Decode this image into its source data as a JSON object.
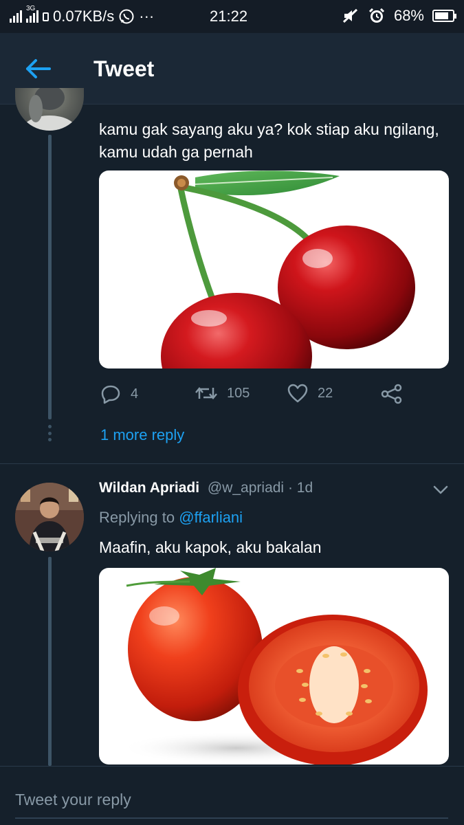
{
  "status_bar": {
    "network": "3G",
    "speed": "0.07KB/s",
    "more": "···",
    "time": "21:22",
    "battery": "68%",
    "battery_level": 0.68
  },
  "header": {
    "title": "Tweet",
    "back_icon": "arrow-left-icon",
    "accent": "#1da1f2"
  },
  "tweets": [
    {
      "text": "kamu gak sayang aku ya? kok stiap aku ngilang, kamu udah ga pernah",
      "media_icon": "cherry-image",
      "replies": "4",
      "retweets": "105",
      "likes": "22",
      "more_replies": "1 more reply"
    },
    {
      "name": "Wildan Apriadi",
      "handle": "@w_apriadi",
      "time": "· 1d",
      "replying_prefix": "Replying to",
      "replying_handle": "@ffarliani",
      "text": "Maafin, aku kapok, aku bakalan",
      "media_icon": "tomato-image"
    }
  ],
  "reply_bar": {
    "placeholder": "Tweet your reply"
  },
  "colors": {
    "background": "#15202b",
    "header": "#1b2836",
    "muted": "#8899a6",
    "link": "#1da1f2"
  }
}
